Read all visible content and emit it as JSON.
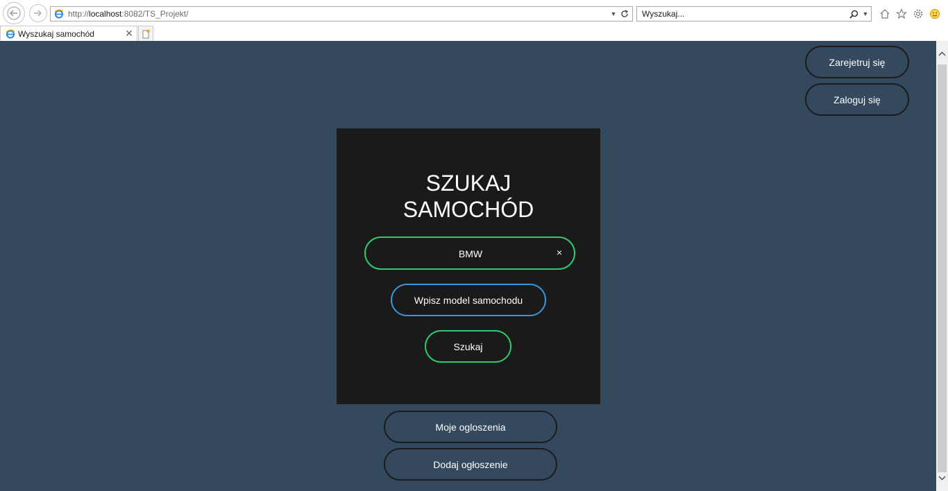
{
  "browser": {
    "address_prefix": "http://",
    "address_host": "localhost",
    "address_rest": ":8082/TS_Projekt/",
    "search_placeholder": "Wyszukaj...",
    "tab_title": "Wyszukaj samochód",
    "icons": {
      "back": "back-arrow-icon",
      "forward": "forward-arrow-icon",
      "page": "ie-logo-icon",
      "refresh": "refresh-icon",
      "search": "magnifier-icon",
      "home": "home-icon",
      "favorites": "star-icon",
      "tools": "gear-icon",
      "feedback": "smiley-icon",
      "close_tab": "close-icon",
      "new_tab": "new-tab-icon"
    }
  },
  "header": {
    "register_label": "Zarejetruj się",
    "login_label": "Zaloguj się"
  },
  "search": {
    "title_line1": "SZUKAJ",
    "title_line2": "SAMOCHÓD",
    "brand_value": "BMW",
    "clear_label": "×",
    "model_label": "Wpisz model samochodu",
    "search_label": "Szukaj"
  },
  "footer_actions": {
    "my_ads_label": "Moje ogloszenia",
    "add_ad_label": "Dodaj ogłoszenie"
  },
  "colors": {
    "page_background": "#34495e",
    "panel_background": "#1a1a1a",
    "accent_green": "#2ecc71",
    "accent_blue": "#3498db",
    "dark_border": "#1c1c1c"
  }
}
